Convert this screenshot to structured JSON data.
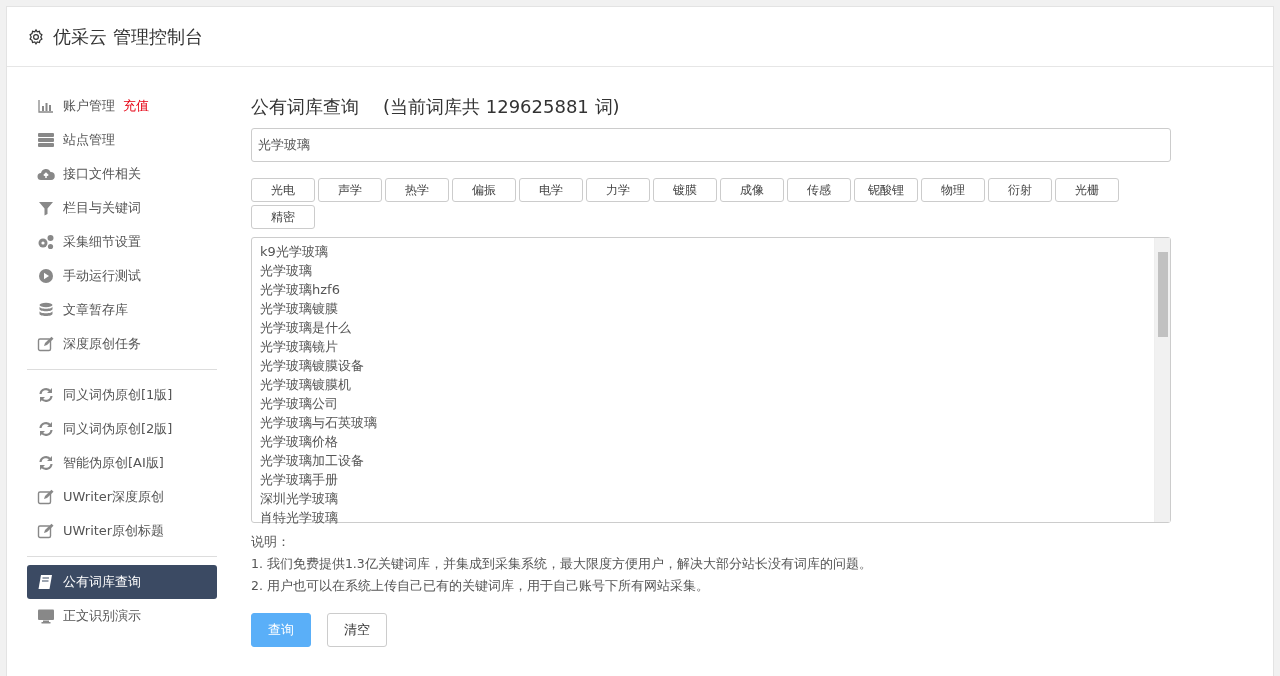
{
  "header": {
    "title": "优采云 管理控制台"
  },
  "sidebar": {
    "groups": [
      {
        "items": [
          {
            "label": "账户管理",
            "extra": "充值",
            "kind": "chart",
            "selected": false
          },
          {
            "label": "站点管理",
            "kind": "server",
            "selected": false
          },
          {
            "label": "接口文件相关",
            "kind": "cloud",
            "selected": false
          },
          {
            "label": "栏目与关键词",
            "kind": "filter",
            "selected": false
          },
          {
            "label": "采集细节设置",
            "kind": "gears",
            "selected": false
          },
          {
            "label": "手动运行测试",
            "kind": "play",
            "selected": false
          },
          {
            "label": "文章暂存库",
            "kind": "database",
            "selected": false
          },
          {
            "label": "深度原创任务",
            "kind": "edit",
            "selected": false
          }
        ]
      },
      {
        "items": [
          {
            "label": "同义词伪原创[1版]",
            "kind": "refresh",
            "selected": false
          },
          {
            "label": "同义词伪原创[2版]",
            "kind": "refresh",
            "selected": false
          },
          {
            "label": "智能伪原创[AI版]",
            "kind": "refresh",
            "selected": false
          },
          {
            "label": "UWriter深度原创",
            "kind": "edit",
            "selected": false
          },
          {
            "label": "UWriter原创标题",
            "kind": "edit",
            "selected": false
          }
        ]
      },
      {
        "items": [
          {
            "label": "公有词库查询",
            "kind": "book",
            "selected": true
          },
          {
            "label": "正文识别演示",
            "kind": "desktop",
            "selected": false
          }
        ]
      }
    ]
  },
  "main": {
    "title": "公有词库查询",
    "count_note": "(当前词库共 129625881 词)",
    "search": {
      "value": "光学玻璃"
    },
    "tags": [
      "光电",
      "声学",
      "热学",
      "偏振",
      "电学",
      "力学",
      "镀膜",
      "成像",
      "传感",
      "铌酸锂",
      "物理",
      "衍射",
      "光栅",
      "精密"
    ],
    "results": [
      "k9光学玻璃",
      "光学玻璃",
      "光学玻璃hzf6",
      "光学玻璃镀膜",
      "光学玻璃是什么",
      "光学玻璃镜片",
      "光学玻璃镀膜设备",
      "光学玻璃镀膜机",
      "光学玻璃公司",
      "光学玻璃与石英玻璃",
      "光学玻璃价格",
      "光学玻璃加工设备",
      "光学玻璃手册",
      "深圳光学玻璃",
      "肖特光学玻璃"
    ],
    "notes_title": "说明：",
    "notes": [
      "1. 我们免费提供1.3亿关键词库，并集成到采集系统，最大限度方便用户，解决大部分站长没有词库的问题。",
      "2. 用户也可以在系统上传自己已有的关键词库，用于自己账号下所有网站采集。"
    ],
    "buttons": [
      {
        "label": "查询",
        "kind": "primary"
      },
      {
        "label": "清空",
        "kind": "plain"
      }
    ]
  }
}
